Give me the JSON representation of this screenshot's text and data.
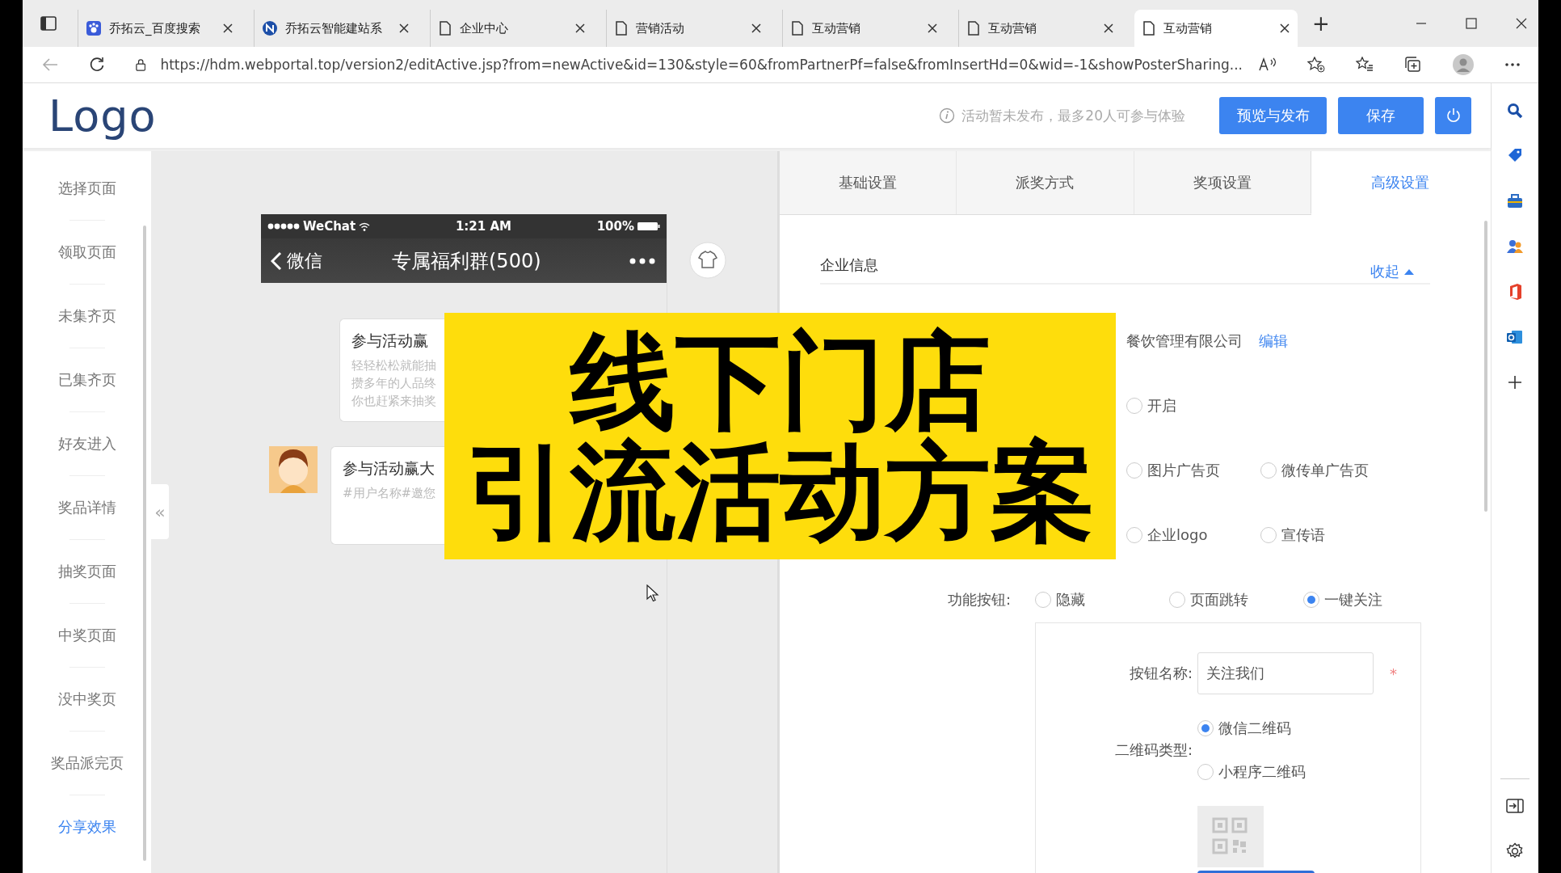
{
  "browser": {
    "tabs": [
      {
        "title": "乔拓云_百度搜索",
        "kind": "paw",
        "selected": false
      },
      {
        "title": "乔拓云智能建站系",
        "kind": "logo",
        "selected": false
      },
      {
        "title": "企业中心",
        "kind": "page",
        "selected": false
      },
      {
        "title": "营销活动",
        "kind": "page",
        "selected": false
      },
      {
        "title": "互动营销",
        "kind": "page",
        "selected": false
      },
      {
        "title": "互动营销",
        "kind": "page",
        "selected": false
      },
      {
        "title": "互动营销",
        "kind": "page",
        "selected": true
      }
    ],
    "new_tab": "+",
    "url": "https://hdm.webportal.top/version2/editActive.jsp?from=newActive&id=130&style=60&fromPartnerPf=false&fromInsertHd=0&wid=-1&showPosterSharing..."
  },
  "header": {
    "logo": "Logo",
    "notice": "活动暂未发布，最多20人可参与体验",
    "buttons": [
      "预览与发布",
      "保存"
    ]
  },
  "nav": [
    {
      "label": "选择页面",
      "selected": false
    },
    {
      "label": "领取页面",
      "selected": false
    },
    {
      "label": "未集齐页",
      "selected": false
    },
    {
      "label": "已集齐页",
      "selected": false
    },
    {
      "label": "好友进入",
      "selected": false
    },
    {
      "label": "奖品详情",
      "selected": false
    },
    {
      "label": "抽奖页面",
      "selected": false
    },
    {
      "label": "中奖页面",
      "selected": false
    },
    {
      "label": "没中奖页",
      "selected": false
    },
    {
      "label": "奖品派完页",
      "selected": false
    },
    {
      "label": "分享效果",
      "selected": true
    }
  ],
  "collapse": "«",
  "phone": {
    "carrier": "WeChat",
    "time": "1:21 AM",
    "battery": "100%",
    "back": "微信",
    "title": "专属福利群(500)",
    "messages": [
      {
        "kind": "card",
        "title": "参与活动赢",
        "lines": [
          "轻轻松松就能抽",
          "攒多年的人品终",
          "你也赶紧来抽奖"
        ]
      },
      {
        "kind": "avatar",
        "title": "参与活动赢大",
        "lines": [
          "#用户名称#邀您"
        ]
      }
    ]
  },
  "settings": {
    "tabs": [
      {
        "label": "基础设置",
        "selected": false
      },
      {
        "label": "派奖方式",
        "selected": false
      },
      {
        "label": "奖项设置",
        "selected": false
      },
      {
        "label": "高级设置",
        "selected": true
      }
    ],
    "section": "企业信息",
    "toggle": "收起",
    "company": "餐饮管理有限公司",
    "edit": "编辑",
    "rows": [
      {
        "options": [
          {
            "label": "开启",
            "selected": false
          }
        ]
      },
      {
        "options": [
          {
            "label": "图片广告页",
            "selected": false
          },
          {
            "label": "微传单广告页",
            "selected": false
          }
        ]
      },
      {
        "options": [
          {
            "label": "企业logo",
            "selected": false
          },
          {
            "label": "宣传语",
            "selected": false
          }
        ]
      },
      {
        "label": "功能按钮:",
        "options": [
          {
            "label": "隐藏",
            "selected": false
          },
          {
            "label": "页面跳转",
            "selected": false
          },
          {
            "label": "一键关注",
            "selected": true
          }
        ]
      }
    ],
    "button_name": {
      "label": "按钮名称:",
      "value": "关注我们",
      "required": "*"
    },
    "qr_type": {
      "label": "二维码类型:",
      "options": [
        {
          "label": "微信二维码",
          "selected": true
        },
        {
          "label": "小程序二维码",
          "selected": false
        }
      ]
    }
  },
  "overlay": {
    "lines": [
      "线下门店",
      "引流活动方案"
    ]
  }
}
